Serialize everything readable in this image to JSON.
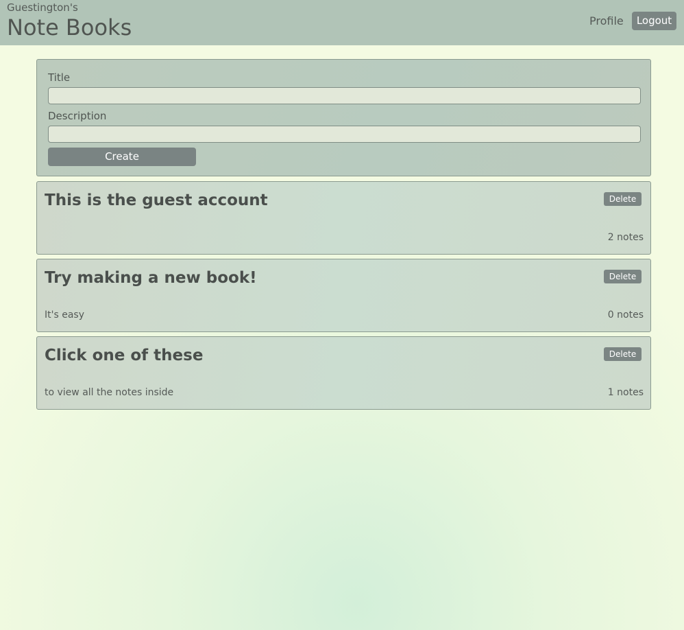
{
  "header": {
    "owner": "Guestington's",
    "title": "Note Books",
    "profile_label": "Profile",
    "logout_label": "Logout"
  },
  "form": {
    "title_label": "Title",
    "title_value": "",
    "description_label": "Description",
    "description_value": "",
    "create_label": "Create"
  },
  "books": [
    {
      "title": "This is the guest account",
      "description": "",
      "count": "2 notes",
      "delete_label": "Delete"
    },
    {
      "title": "Try making a new book!",
      "description": "It's easy",
      "count": "0 notes",
      "delete_label": "Delete"
    },
    {
      "title": "Click one of these",
      "description": "to view all the notes inside",
      "count": "1 notes",
      "delete_label": "Delete"
    }
  ],
  "colors": {
    "header_bg": "#b1c4b7",
    "button_bg": "#7b8583",
    "card_bg": "#cdd9cc"
  }
}
